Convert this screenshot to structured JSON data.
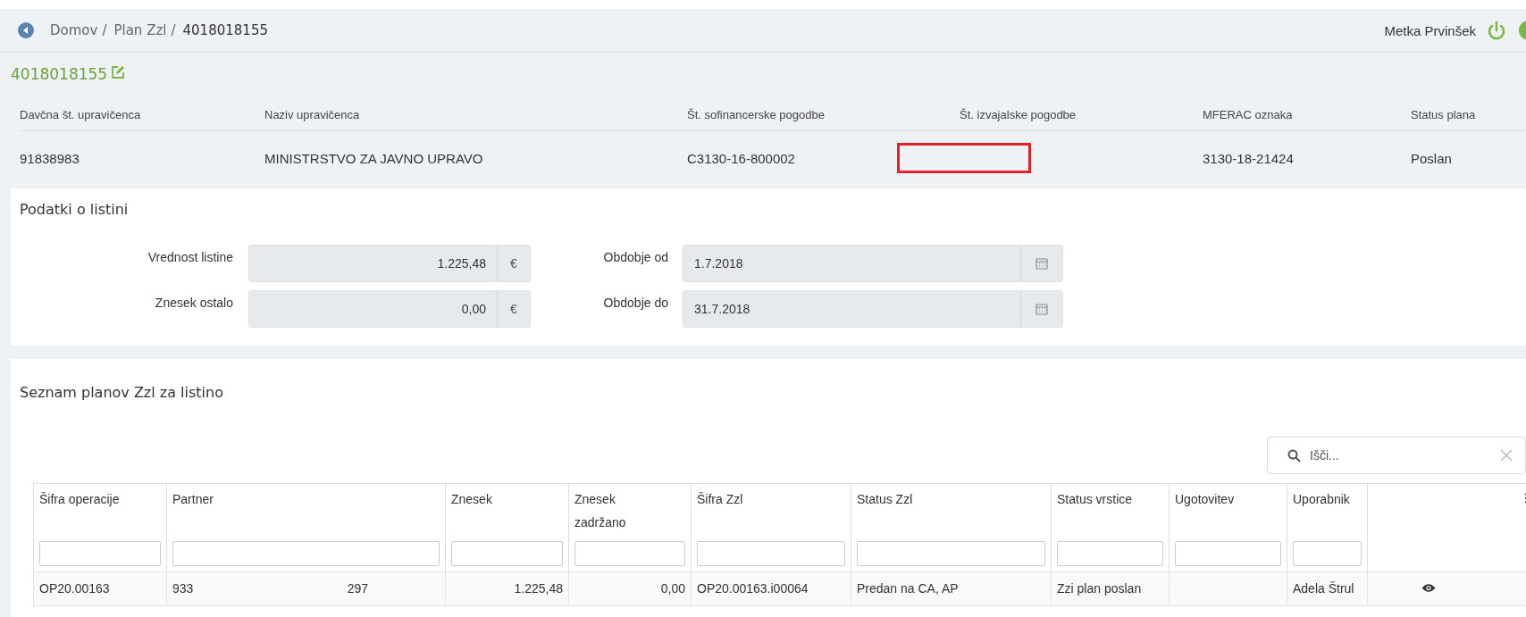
{
  "breadcrumb": [
    {
      "label": "Domov",
      "separator": "/"
    },
    {
      "label": "Plan Zzl",
      "separator": "/"
    },
    {
      "label": "4018018155"
    }
  ],
  "user": {
    "name": "Metka Prvinšek"
  },
  "title": "4018018155",
  "summary": {
    "columns": [
      "Davčna št. upravičenca",
      "Naziv upravičenca",
      "Št. sofinancerske pogodbe",
      "Št. izvajalske pogodbe",
      "MFERAC oznaka",
      "Status plana"
    ],
    "values": [
      {
        "kind": "text",
        "text": "91838983"
      },
      {
        "kind": "text",
        "text": "MINISTRSTVO ZA JAVNO UPRAVO"
      },
      {
        "kind": "text",
        "text": "C3130-16-800002"
      },
      {
        "kind": "redacted"
      },
      {
        "kind": "text",
        "text": "3130-18-21424"
      },
      {
        "kind": "text",
        "text": "Poslan"
      }
    ]
  },
  "document": {
    "title": "Podatki o listini",
    "fields": [
      {
        "label": "Vrednost listine",
        "value": "1.225,48",
        "addon": "€",
        "kind": "amount"
      },
      {
        "label": "Obdobje od",
        "value": "1.7.2018",
        "kind": "date"
      },
      {
        "label": "Znesek ostalo",
        "value": "0,00",
        "addon": "€",
        "kind": "amount"
      },
      {
        "label": "Obdobje do",
        "value": "31.7.2018",
        "kind": "date"
      }
    ]
  },
  "plans": {
    "title": "Seznam planov Zzl za listino",
    "search": {
      "placeholder": "Išči..."
    },
    "columns": [
      {
        "label": "Šifra operacije",
        "kind": "text"
      },
      {
        "label": "Partner",
        "kind": "text"
      },
      {
        "label": "Znesek",
        "kind": "number"
      },
      {
        "label": "Znesek zadržano",
        "kind": "number"
      },
      {
        "label": "Šifra Zzl",
        "kind": "text"
      },
      {
        "label": "Status Zzl",
        "kind": "text"
      },
      {
        "label": "Status vrstice",
        "kind": "text"
      },
      {
        "label": "Ugotovitev",
        "kind": "text"
      },
      {
        "label": "Uporabnik",
        "kind": "text"
      }
    ],
    "rows": [
      {
        "cells": [
          [
            "OP20.00163"
          ],
          [
            "933",
            "297"
          ],
          [
            "1.225,48"
          ],
          [
            "0,00"
          ],
          [
            "OP20.00163.i00064"
          ],
          [
            "Predan na CA, AP"
          ],
          [
            "Zzi plan poslan"
          ],
          [],
          [
            "Adela Štrul"
          ]
        ]
      }
    ]
  }
}
